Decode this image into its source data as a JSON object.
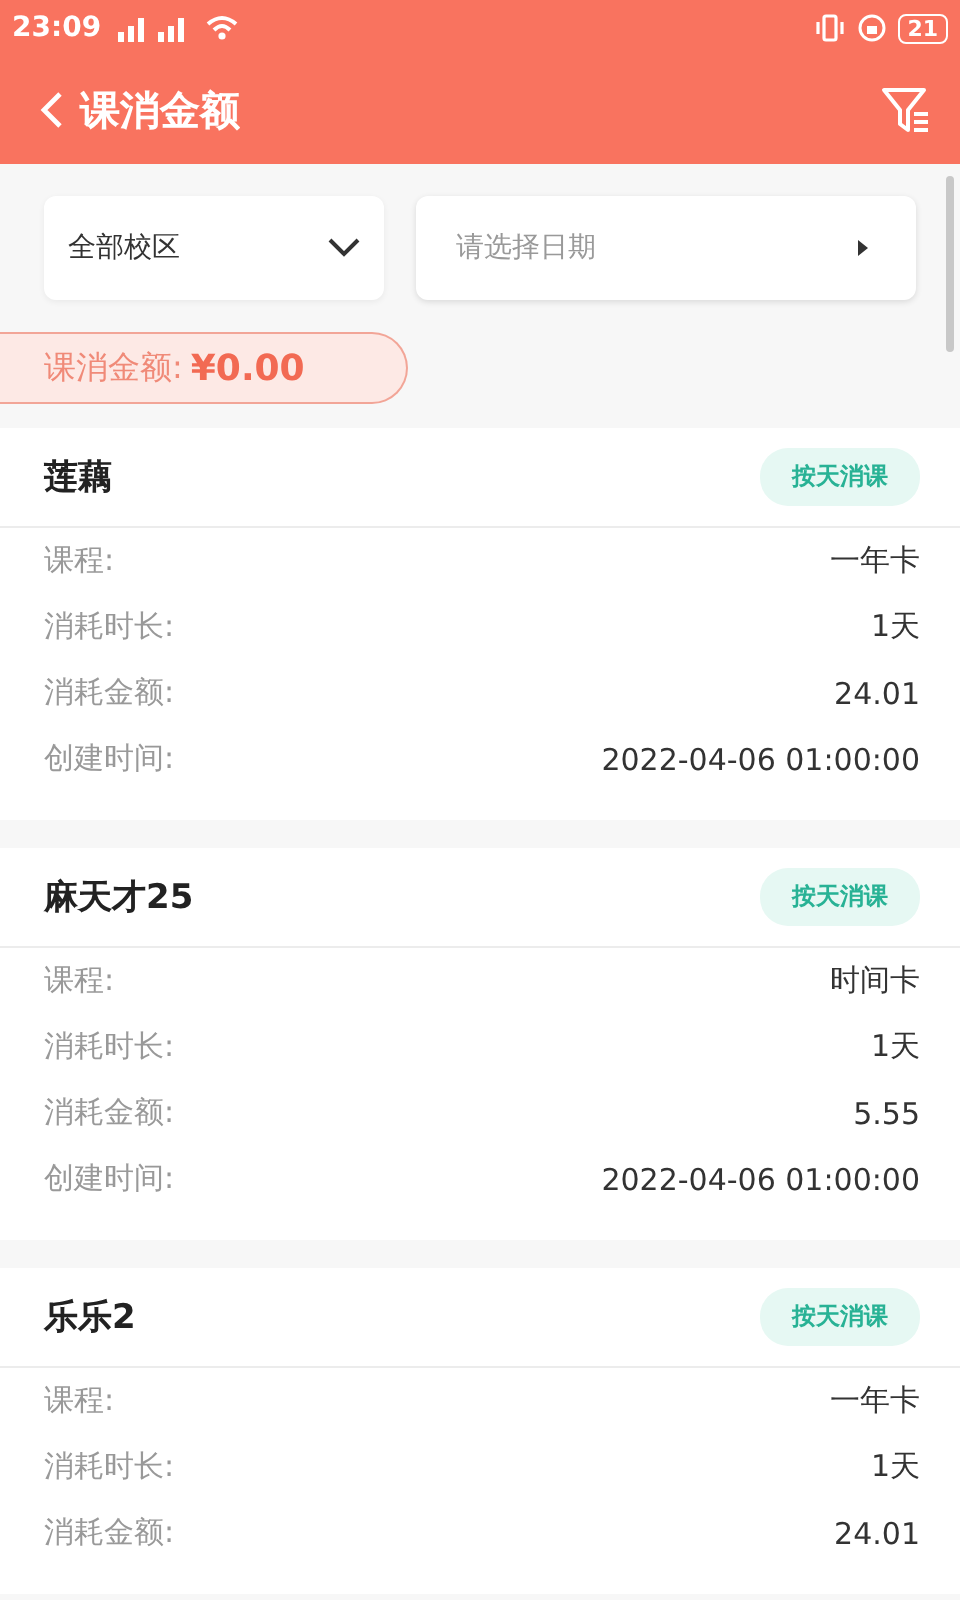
{
  "status_bar": {
    "time": "23:09",
    "battery": "21"
  },
  "header": {
    "title": "课消金额"
  },
  "filters": {
    "campus": "全部校区",
    "date": {
      "placeholder": "请选择日期"
    }
  },
  "total": {
    "label": "课消金额:",
    "amount": "¥0.00"
  },
  "records": [
    {
      "name": "莲藕",
      "tag": "按天消课",
      "rows": [
        {
          "label": "课程:",
          "value": "一年卡"
        },
        {
          "label": "消耗时长:",
          "value": "1天"
        },
        {
          "label": "消耗金额:",
          "value": "24.01"
        },
        {
          "label": "创建时间:",
          "value": "2022-04-06 01:00:00"
        }
      ]
    },
    {
      "name": "麻天才25",
      "tag": "按天消课",
      "rows": [
        {
          "label": "课程:",
          "value": "时间卡"
        },
        {
          "label": "消耗时长:",
          "value": "1天"
        },
        {
          "label": "消耗金额:",
          "value": "5.55"
        },
        {
          "label": "创建时间:",
          "value": "2022-04-06 01:00:00"
        }
      ]
    },
    {
      "name": "乐乐2",
      "tag": "按天消课",
      "rows": [
        {
          "label": "课程:",
          "value": "一年卡"
        },
        {
          "label": "消耗时长:",
          "value": "1天"
        },
        {
          "label": "消耗金额:",
          "value": "24.01"
        }
      ]
    }
  ]
}
